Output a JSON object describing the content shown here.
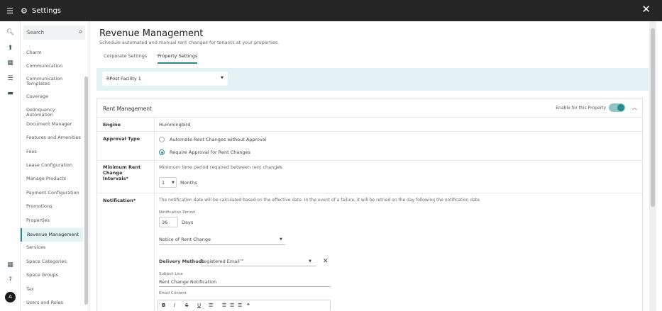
{
  "topbar": {
    "title": "Settings",
    "menu_icon": "hamburger-menu-icon",
    "gear_icon": "gear-icon",
    "close_icon": "close-icon"
  },
  "rail": {
    "icons": [
      "search-icon",
      "upload-icon",
      "calendar-icon",
      "checklist-icon",
      "chat-icon",
      "grid-icon",
      "help-icon"
    ],
    "avatar_letter": "A"
  },
  "nav": {
    "search_placeholder": "Search",
    "items": [
      "Charm",
      "Communication",
      "Communication Templates",
      "Coverage",
      "Delinquency Automation",
      "Document Manager",
      "Features and Amenities",
      "Fees",
      "Lease Configuration",
      "Manage Products",
      "Payment Configuration",
      "Promotions",
      "Properties",
      "Revenue Management",
      "Services",
      "Space Categories",
      "Space Groups",
      "Tax",
      "Users and Roles"
    ],
    "active_item": "Revenue Management"
  },
  "page": {
    "title": "Revenue Management",
    "subtitle": "Schedule automated and manual rent changes for tenants at your properties.",
    "tabs": [
      "Corporate Settings",
      "Property Settings"
    ],
    "active_tab": "Property Settings"
  },
  "facility": {
    "selected": "RPost Facility 1"
  },
  "rent_management": {
    "title": "Rent Management",
    "enable_label": "Enable for this Property",
    "enabled": true,
    "engine_label": "Engine",
    "engine_value": "Hummingbird",
    "approval_label": "Approval Type",
    "approval_options": [
      "Automate Rent Changes without Approval",
      "Require Approval for Rent Changes"
    ],
    "approval_selected": "Require Approval for Rent Changes",
    "interval_label": "Minimum Rent Change Intervals*",
    "interval_desc": "Minimum time period required between rent changes",
    "interval_value": "1",
    "interval_unit": "Months",
    "notification_label": "Notification*",
    "notification_desc": "The notification date will be calculated based on the effective date. In the event of a failure, it will be retried on the day following the notification date.",
    "notification_period_label": "Notification Period",
    "notification_period_value": "36",
    "notification_period_unit": "Days",
    "notice_select": "Notice of Rent Change",
    "delivery_method_label": "Delivery Method:",
    "delivery_method_value": "Registered Email™",
    "subject_label": "Subject Line",
    "subject_value": "Rent Change Notification",
    "email_content_label": "Email Content",
    "toolbar": [
      "B",
      "I",
      "S",
      "U"
    ]
  }
}
